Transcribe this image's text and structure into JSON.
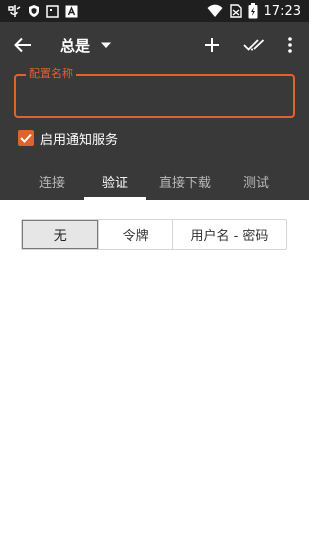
{
  "status_bar": {
    "time": "17:23",
    "left_icons": [
      "app-notification-icon",
      "shield-icon",
      "square-icon",
      "font-icon"
    ],
    "right_icons": [
      "wifi-icon",
      "no-sim-icon",
      "battery-charging-icon"
    ]
  },
  "toolbar": {
    "title": "总是",
    "icons": [
      "back-arrow-icon",
      "dropdown-arrow-icon",
      "add-icon",
      "double-check-icon",
      "more-vert-icon"
    ]
  },
  "config_name": {
    "label": "配置名称",
    "value": ""
  },
  "notify": {
    "label": "启用通知服务",
    "checked": true
  },
  "tabs": [
    {
      "label": "连接",
      "active": false
    },
    {
      "label": "验证",
      "active": true
    },
    {
      "label": "直接下载",
      "active": false
    },
    {
      "label": "测试",
      "active": false
    }
  ],
  "auth_options": [
    {
      "label": "无",
      "selected": true
    },
    {
      "label": "令牌",
      "selected": false
    },
    {
      "label": "用户名 - 密码",
      "selected": false
    }
  ],
  "colors": {
    "accent": "#e0622c",
    "appbar": "#393939",
    "statusbar": "#1f1f1f"
  }
}
